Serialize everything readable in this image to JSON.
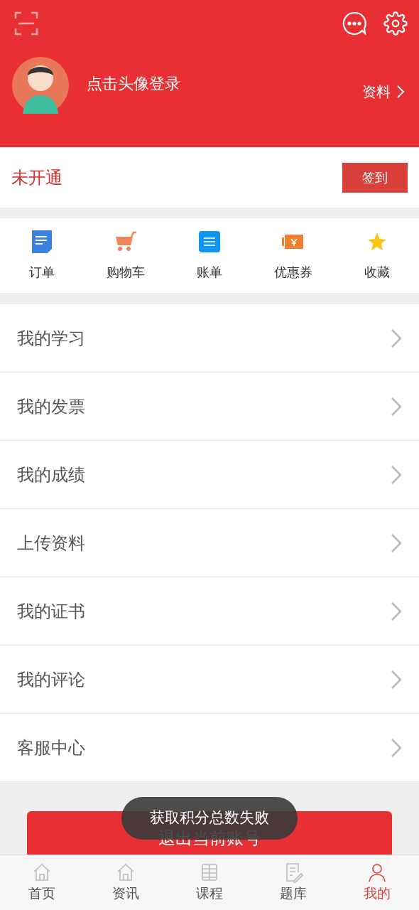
{
  "header": {
    "login_prompt": "点击头像登录",
    "profile_link": "资料"
  },
  "membership": {
    "status": "未开通",
    "checkin_button": "签到"
  },
  "shortcuts": [
    {
      "kind": "order",
      "label": "订单"
    },
    {
      "kind": "cart",
      "label": "购物车"
    },
    {
      "kind": "bill",
      "label": "账单"
    },
    {
      "kind": "coupon",
      "label": "优惠券"
    },
    {
      "kind": "favorite",
      "label": "收藏"
    }
  ],
  "menu_items": [
    "我的学习",
    "我的发票",
    "我的成绩",
    "上传资料",
    "我的证书",
    "我的评论",
    "客服中心"
  ],
  "logout_button": "退出当前账号",
  "toast": "获取积分总数失败",
  "tabs": [
    {
      "kind": "home",
      "label": "首页",
      "selected": false
    },
    {
      "kind": "news",
      "label": "资讯",
      "selected": false
    },
    {
      "kind": "course",
      "label": "课程",
      "selected": false
    },
    {
      "kind": "quiz",
      "label": "题库",
      "selected": false
    },
    {
      "kind": "me",
      "label": "我的",
      "selected": true
    }
  ]
}
